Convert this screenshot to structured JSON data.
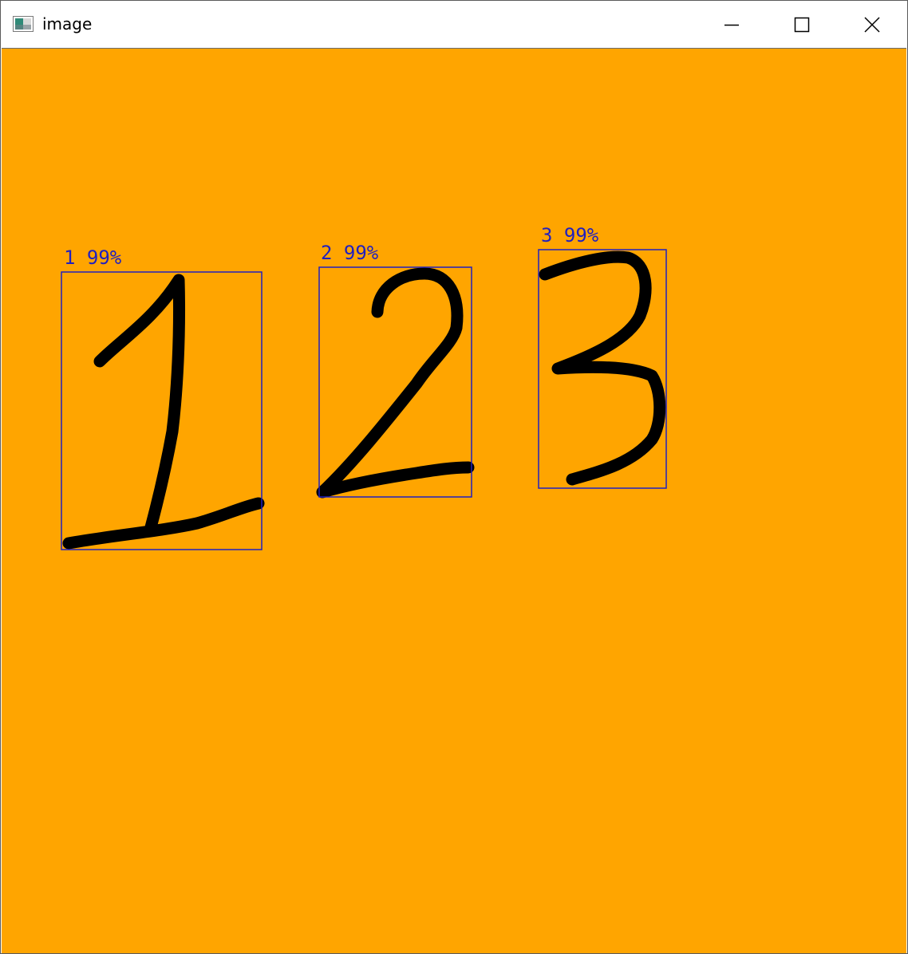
{
  "window": {
    "title": "image",
    "app_icon": "opencv-window-icon",
    "controls": {
      "minimize_icon": "minimize-icon",
      "maximize_icon": "maximize-icon",
      "close_icon": "close-icon"
    }
  },
  "canvas": {
    "background_color": "#FFA500",
    "box_color": "#2020C0",
    "stroke_color": "#000000"
  },
  "detections": [
    {
      "digit": "1",
      "confidence": "99%",
      "label": "1 99%"
    },
    {
      "digit": "2",
      "confidence": "99%",
      "label": "2 99%"
    },
    {
      "digit": "3",
      "confidence": "99%",
      "label": "3 99%"
    }
  ]
}
